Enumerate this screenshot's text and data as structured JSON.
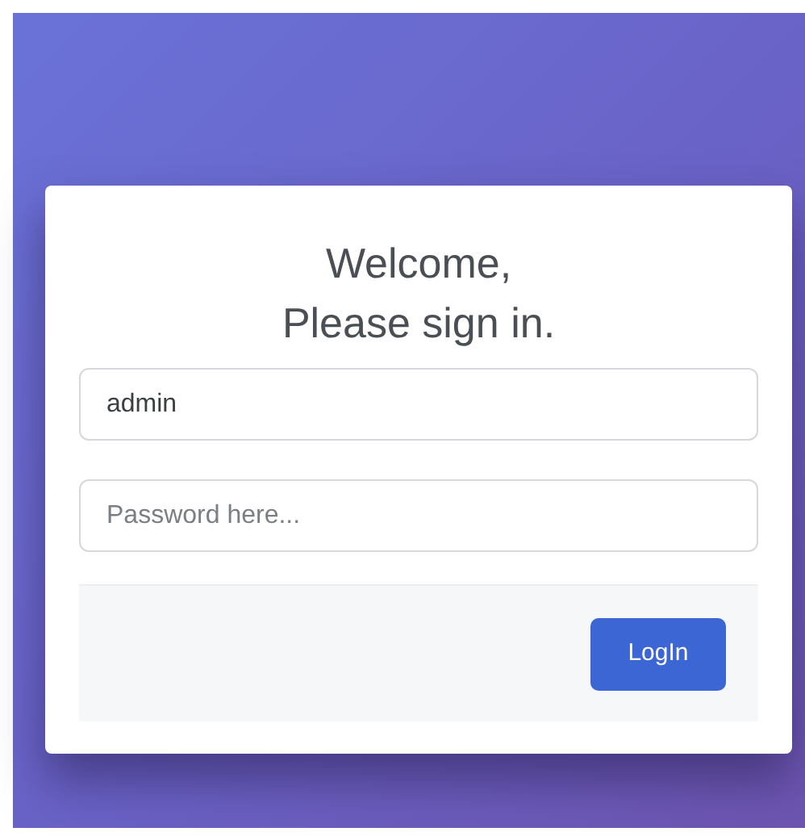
{
  "title": "Welcome,\nPlease sign in.",
  "fields": [
    {
      "kind": "text",
      "value": "admin"
    },
    {
      "kind": "password",
      "placeholder": "Password here..."
    }
  ],
  "buttons": [
    "LogIn"
  ]
}
